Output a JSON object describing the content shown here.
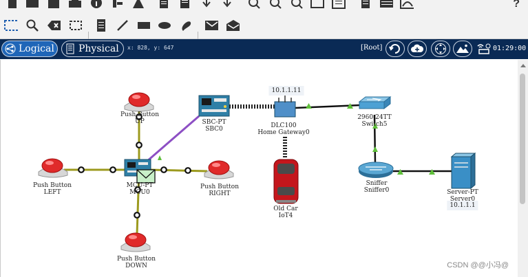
{
  "tabs": {
    "logical": "Logical",
    "physical": "Physical"
  },
  "coords": "x: 828, y: 647",
  "root_label": "[Root]",
  "clock": "01:29:00",
  "devices": {
    "button_up": [
      "Push Button",
      "UP"
    ],
    "button_left": [
      "Push Button",
      "LEFT"
    ],
    "button_right": [
      "Push Button",
      "RIGHT"
    ],
    "button_down": [
      "Push Button",
      "DOWN"
    ],
    "mcu": [
      "MCU-PT",
      "MCU0"
    ],
    "sbc": [
      "SBC-PT",
      "SBC0"
    ],
    "gateway": [
      "DLC100",
      "Home Gateway0"
    ],
    "switch": [
      "2960-24TT",
      "Switch5"
    ],
    "sniffer": [
      "Sniffer",
      "Sniffer0"
    ],
    "server": [
      "Server-PT",
      "Server0"
    ],
    "car": [
      "Old Car",
      "IoT4"
    ]
  },
  "ip_gateway": "10.1.1.11",
  "ip_server": "10.1.1.1",
  "watermark": "CSDN @@小冯@",
  "colors": {
    "navbar": "#0a2a55",
    "active_tab": "#1f66b8",
    "iot_link": "#9c9a1e",
    "sbc_link": "#8d4fc4",
    "ethernet": "#111111",
    "link_up": "#5fbf3a"
  },
  "toolbar_icons": [
    "save-icon",
    "print-icon",
    "info-icon",
    "network-icon",
    "copy-icon",
    "paste-icon",
    "undo-icon",
    "redo-icon",
    "zoom-in-icon",
    "zoom-reset-icon",
    "zoom-out-icon",
    "rectangle-icon",
    "palette-icon",
    "note-icon",
    "custom-device-icon",
    "pdu-icon"
  ],
  "tool_icons": [
    "select-icon",
    "inspect-icon",
    "delete-icon",
    "resize-icon",
    "note-icon",
    "line-icon",
    "rectangle-icon",
    "ellipse-icon",
    "freeform-icon",
    "simple-pdu-icon",
    "complex-pdu-icon"
  ]
}
